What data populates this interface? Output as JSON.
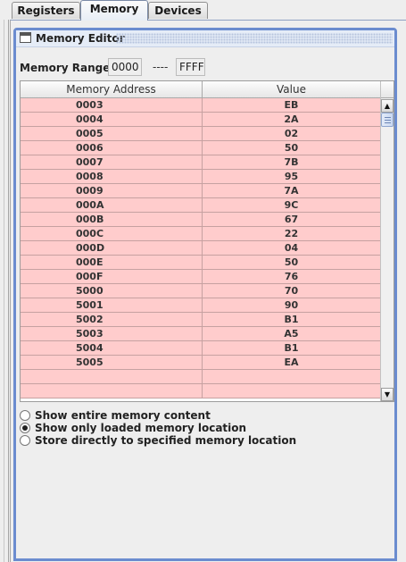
{
  "tabs": [
    {
      "label": "Registers"
    },
    {
      "label": "Memory"
    },
    {
      "label": "Devices"
    }
  ],
  "active_tab": "Memory",
  "frame": {
    "title": "Memory Editor"
  },
  "range": {
    "label": "Memory Range:",
    "start": "0000",
    "separator": "----",
    "end": "FFFF"
  },
  "table": {
    "headers": {
      "address": "Memory Address",
      "value": "Value"
    },
    "rows": [
      {
        "address": "0003",
        "value": "EB"
      },
      {
        "address": "0004",
        "value": "2A"
      },
      {
        "address": "0005",
        "value": "02"
      },
      {
        "address": "0006",
        "value": "50"
      },
      {
        "address": "0007",
        "value": "7B"
      },
      {
        "address": "0008",
        "value": "95"
      },
      {
        "address": "0009",
        "value": "7A"
      },
      {
        "address": "000A",
        "value": "9C"
      },
      {
        "address": "000B",
        "value": "67"
      },
      {
        "address": "000C",
        "value": "22"
      },
      {
        "address": "000D",
        "value": "04"
      },
      {
        "address": "000E",
        "value": "50"
      },
      {
        "address": "000F",
        "value": "76"
      },
      {
        "address": "5000",
        "value": "70"
      },
      {
        "address": "5001",
        "value": "90"
      },
      {
        "address": "5002",
        "value": "B1"
      },
      {
        "address": "5003",
        "value": "A5"
      },
      {
        "address": "5004",
        "value": "B1"
      },
      {
        "address": "5005",
        "value": "EA"
      },
      {
        "address": "",
        "value": ""
      },
      {
        "address": "",
        "value": ""
      }
    ],
    "row_color": "#ffcccc"
  },
  "options": [
    {
      "label": "Show entire memory content",
      "selected": false
    },
    {
      "label": "Show only loaded memory location",
      "selected": true
    },
    {
      "label": "Store directly to specified memory location",
      "selected": false
    }
  ],
  "colors": {
    "frame_border": "#6b8ccf",
    "row_fill": "#ffcccc"
  }
}
